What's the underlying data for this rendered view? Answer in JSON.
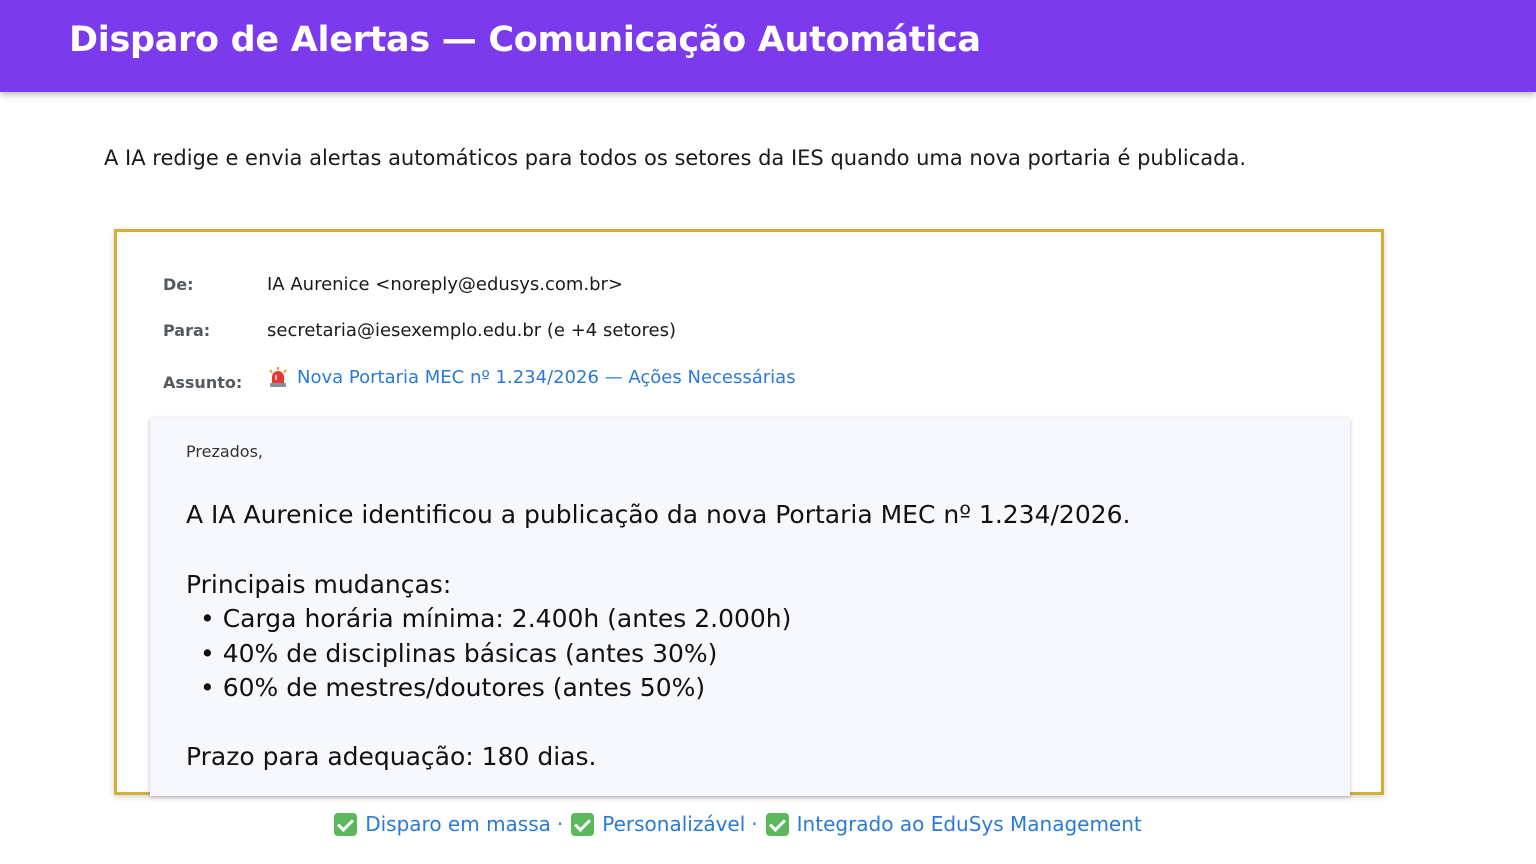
{
  "header": {
    "title": "Disparo de Alertas — Comunicação Automática"
  },
  "intro": "A IA redige e envia alertas automáticos para todos os setores da IES quando uma nova portaria é publicada.",
  "email": {
    "from_label": "De:",
    "from_value": "IA Aurenice <noreply@edusys.com.br>",
    "to_label": "Para:",
    "to_value": "secretaria@iesexemplo.edu.br (e +4 setores)",
    "subject_label": "Assunto:",
    "subject_icon": "siren-icon",
    "subject_value": "Nova Portaria MEC nº 1.234/2026 — Ações Necessárias",
    "body": {
      "greeting": "Prezados,",
      "line1": "A IA Aurenice identificou a publicação da nova Portaria MEC nº 1.234/2026.",
      "changes_title": "Principais mudanças:",
      "changes": [
        "• Carga horária mínima: 2.400h (antes 2.000h)",
        "• 40% de disciplinas básicas (antes 30%)",
        "• 60% de mestres/doutores (antes 50%)"
      ],
      "deadline": "Prazo para adequação: 180 dias."
    }
  },
  "features": [
    {
      "icon": "check-icon",
      "label": "Disparo em massa"
    },
    {
      "icon": "check-icon",
      "label": "Personalizável"
    },
    {
      "icon": "check-icon",
      "label": "Integrado ao EduSys Management"
    }
  ],
  "feature_separator": "·",
  "colors": {
    "topbar": "#7c3aed",
    "frame_border": "#d4af37",
    "link_blue": "#2a7ad9",
    "check_green": "#5cb85c"
  }
}
